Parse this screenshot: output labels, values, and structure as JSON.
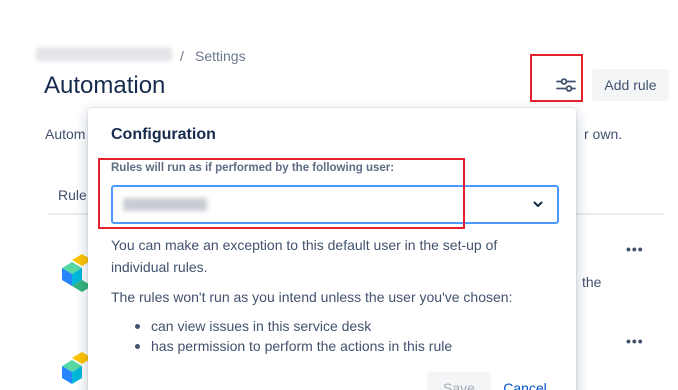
{
  "breadcrumb": {
    "separator": "/",
    "current": "Settings"
  },
  "page": {
    "title": "Automation",
    "description_visible_start": "Autom",
    "description_visible_end": "r own."
  },
  "toolbar": {
    "configure_icon": "sliders-icon",
    "add_rule_label": "Add rule"
  },
  "tabs": {
    "first_tab_visible": "Rule"
  },
  "rules_list": {
    "row_visible_text": "the",
    "more_icon": "more-horizontal-icon",
    "rule_icon": "automation-cube-icon"
  },
  "config_popup": {
    "title": "Configuration",
    "user_field_label": "Rules will run as if performed by the following user:",
    "chevron_icon": "chevron-down-icon",
    "exception_text": "You can make an exception to this default user in the set-up of individual rules.",
    "warning_text": "The rules won't run as you intend unless the user you've chosen:",
    "conditions": [
      "can view issues in this service desk",
      "has permission to perform the actions in this rule"
    ],
    "save_label": "Save",
    "cancel_label": "Cancel"
  },
  "colors": {
    "primary_text": "#172b4d",
    "secondary_text": "#42526e",
    "focus_border": "#4c9aff",
    "link": "#0052cc",
    "annotation_red": "#e5202e"
  }
}
